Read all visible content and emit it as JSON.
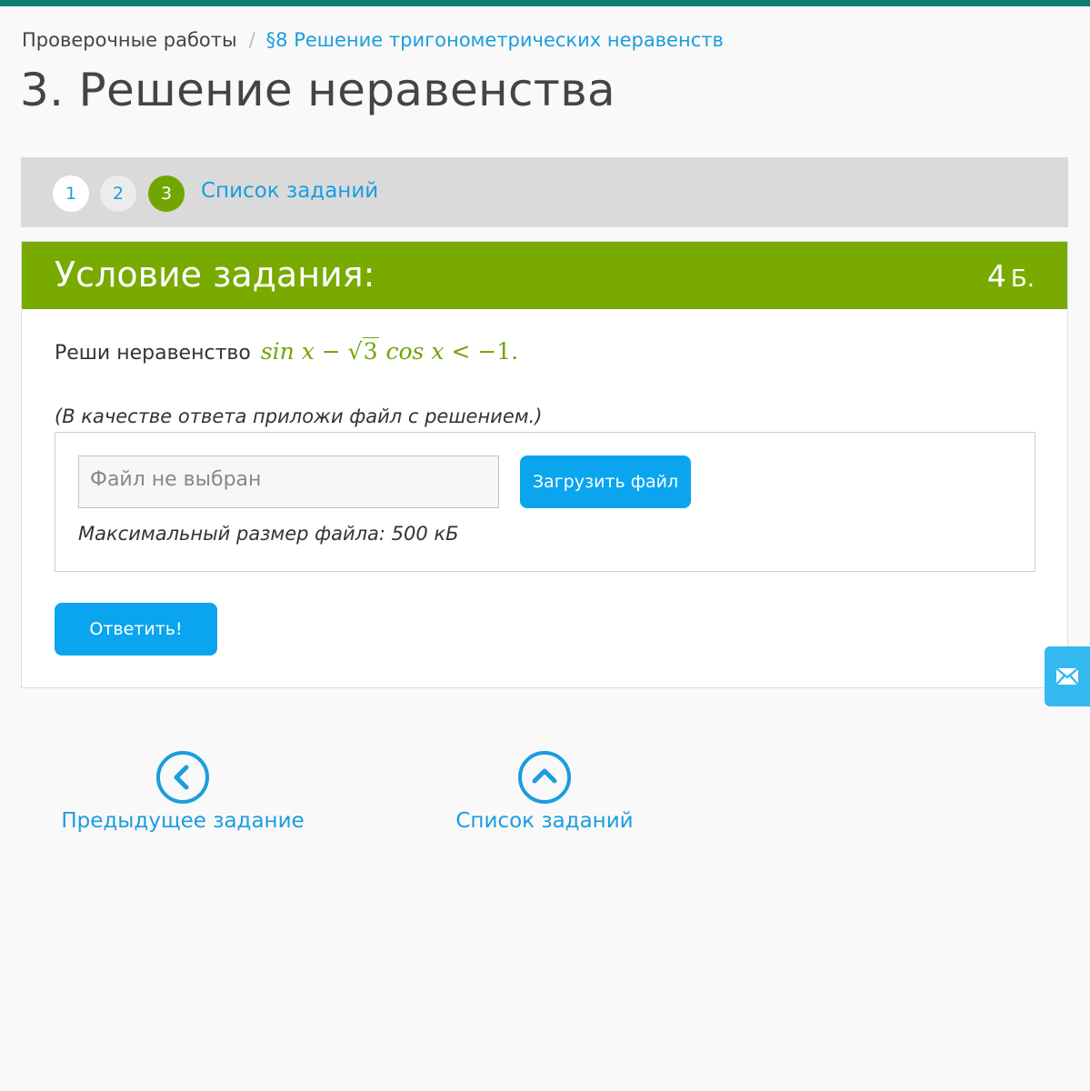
{
  "breadcrumb": {
    "root": "Проверочные работы",
    "separator": "/",
    "current": "§8 Решение тригонометрических неравенств"
  },
  "page_title": "3. Решение неравенства",
  "steps": {
    "items": [
      "1",
      "2",
      "3"
    ],
    "active_step": "3",
    "list_link": "Список заданий"
  },
  "task": {
    "header": "Условие задания:",
    "points_value": "4",
    "points_unit": "Б.",
    "question_text": "Реши неравенство",
    "formula": {
      "sin": "sin",
      "x1": "x",
      "minus": "−",
      "sqrt_sign": "√",
      "radicand": "3",
      "cos": "cos",
      "x2": "x",
      "less": "<",
      "rhs": "−1",
      "dot": "."
    },
    "note": "(В качестве ответа приложи файл с решением.)"
  },
  "upload": {
    "file_placeholder": "Файл не выбран",
    "button_label": "Загрузить файл",
    "max_size": "Максимальный размер файла: 500 кБ"
  },
  "answer_button": "Ответить!",
  "bottom_nav": {
    "prev_label": "Предыдущее задание",
    "list_label": "Список заданий"
  },
  "icons": {
    "prev": "chevron-left-circle-icon",
    "list": "chevron-up-circle-icon",
    "feedback": "envelope-icon"
  },
  "colors": {
    "top_bar": "#0e7f6e",
    "accent_green": "#78aa00",
    "link_blue": "#1a9de0",
    "button_blue": "#0aa5ee"
  }
}
